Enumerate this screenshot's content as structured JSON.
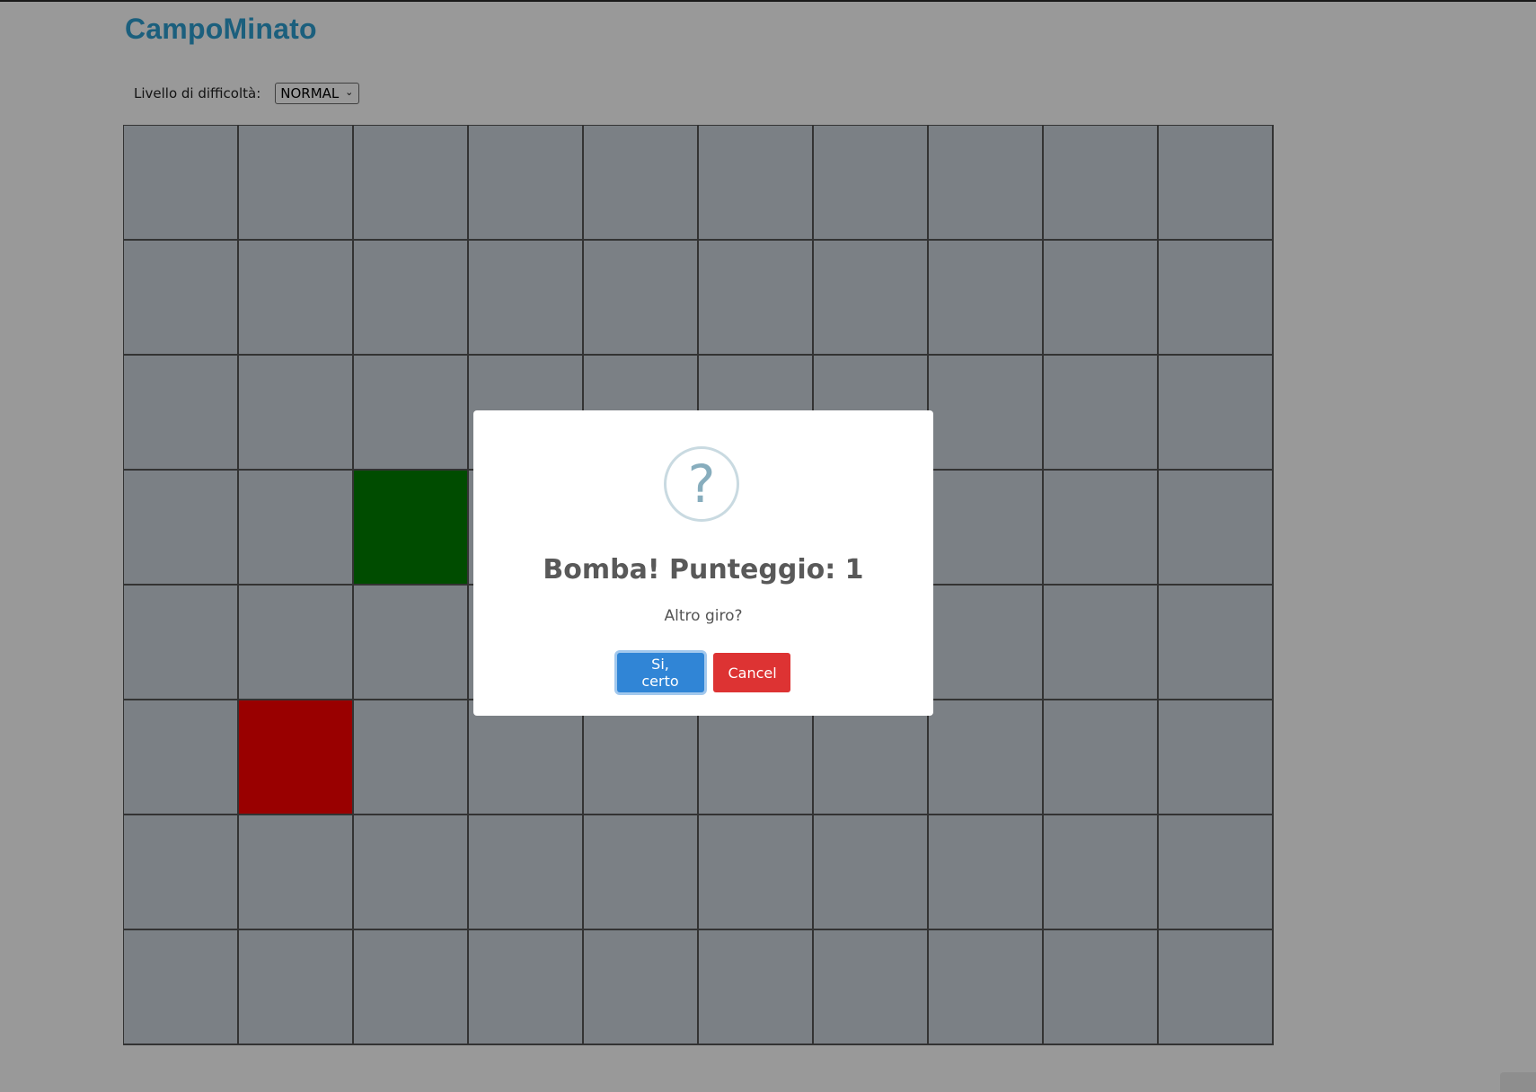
{
  "header": {
    "title": "CampoMinato"
  },
  "difficulty": {
    "label": "Livello di difficoltà:",
    "selected": "NORMAL"
  },
  "board": {
    "columns": 10,
    "rows": 8,
    "revealed": [
      {
        "row": 4,
        "col": 3,
        "state": "safe"
      },
      {
        "row": 6,
        "col": 2,
        "state": "bomb"
      }
    ]
  },
  "dialog": {
    "icon": "question-icon",
    "icon_glyph": "?",
    "title": "Bomba! Punteggio: 1",
    "message": "Altro giro?",
    "confirm_label": "Si, certo",
    "cancel_label": "Cancel"
  },
  "colors": {
    "title": "#2e9fd0",
    "cell": "#cdd6de",
    "safe_cell": "#007f00",
    "bomb_cell": "#ff0000",
    "confirm_button": "#3085d6",
    "cancel_button": "#dd3333"
  }
}
